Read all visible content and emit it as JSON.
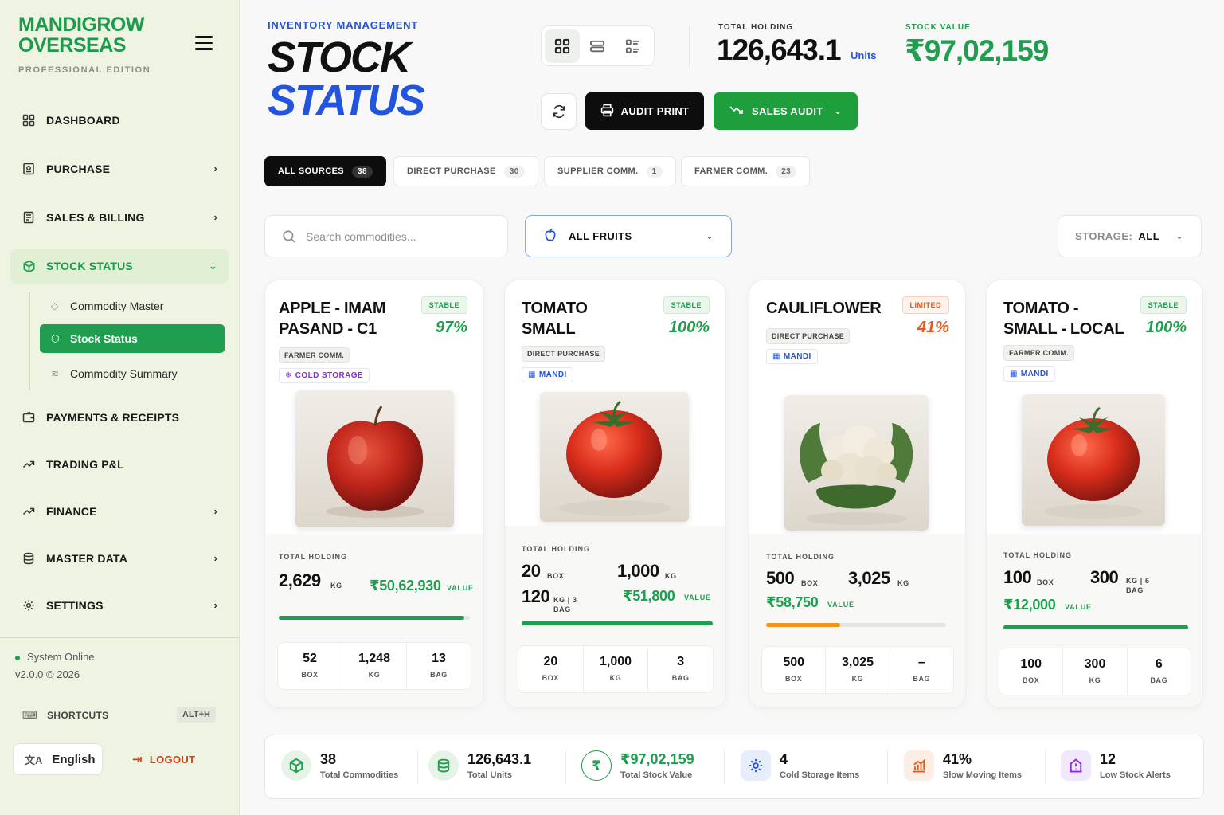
{
  "brand": {
    "name": "MANDIGROW OVERSEAS",
    "name_line1": "MANDIGROW",
    "name_line2": "OVERSEAS",
    "edition": "PROFESSIONAL EDITION"
  },
  "sidebar": {
    "items": [
      {
        "label": "DASHBOARD",
        "icon": "grid-icon",
        "has_chevron": false
      },
      {
        "label": "PURCHASE",
        "icon": "receipt-icon",
        "has_chevron": true
      },
      {
        "label": "SALES & BILLING",
        "icon": "invoice-icon",
        "has_chevron": true
      },
      {
        "label": "STOCK STATUS",
        "icon": "box-icon",
        "has_chevron": true,
        "active": true
      },
      {
        "label": "PAYMENTS & RECEIPTS",
        "icon": "wallet-icon",
        "has_chevron": false
      },
      {
        "label": "TRADING P&L",
        "icon": "trend-icon",
        "has_chevron": false
      },
      {
        "label": "FINANCE",
        "icon": "trend-icon",
        "has_chevron": true
      },
      {
        "label": "MASTER DATA",
        "icon": "database-icon",
        "has_chevron": true
      },
      {
        "label": "SETTINGS",
        "icon": "gear-icon",
        "has_chevron": true
      }
    ],
    "sub_items": [
      {
        "label": "Commodity Master",
        "icon": "tag-icon"
      },
      {
        "label": "Stock Status",
        "icon": "box-icon",
        "active": true
      },
      {
        "label": "Commodity Summary",
        "icon": "layers-icon"
      }
    ],
    "status": "System Online",
    "version": "v2.0.0 © 2026",
    "shortcuts_label": "SHORTCUTS",
    "shortcuts_key": "ALT+H",
    "language": "English",
    "logout": "LOGOUT"
  },
  "header": {
    "kicker": "INVENTORY MANAGEMENT",
    "title_line1": "STOCK",
    "title_line2": "STATUS",
    "total_holding_label": "TOTAL HOLDING",
    "total_holding_value": "126,643.1",
    "total_holding_unit": "Units",
    "stock_value_label": "STOCK VALUE",
    "stock_value": "₹97,02,159",
    "audit_print": "AUDIT PRINT",
    "sales_audit": "SALES AUDIT"
  },
  "filters": {
    "pills": [
      {
        "label": "ALL SOURCES",
        "count": "38",
        "active": true
      },
      {
        "label": "DIRECT PURCHASE",
        "count": "30"
      },
      {
        "label": "SUPPLIER COMM.",
        "count": "1"
      },
      {
        "label": "FARMER COMM.",
        "count": "23"
      }
    ],
    "search_placeholder": "Search commodities...",
    "category": "ALL FRUITS",
    "storage_label": "STORAGE:",
    "storage_value": "ALL"
  },
  "cards": [
    {
      "name": "APPLE - IMAM PASAND - C1",
      "name_line1": "APPLE - IMAM",
      "name_line2": "PASAND - C1",
      "badge": "STABLE",
      "percent": "97%",
      "source": "FARMER COMM.",
      "tag": "COLD STORAGE",
      "holding_label": "TOTAL HOLDING",
      "holding_value": "2,629",
      "holding_unit": "KG",
      "value": "₹50,62,930",
      "value_label": "VALUE",
      "progress": 0.97,
      "stats": [
        {
          "num": "52",
          "unit": "BOX"
        },
        {
          "num": "1,248",
          "unit": "KG"
        },
        {
          "num": "13",
          "unit": "BAG"
        }
      ]
    },
    {
      "name": "TOMATO SMALL",
      "name_line1": "TOMATO",
      "name_line2": "SMALL",
      "badge": "STABLE",
      "percent": "100%",
      "source": "DIRECT PURCHASE",
      "tag": "MANDI",
      "holding_label": "TOTAL HOLDING",
      "h1_value": "20",
      "h1_unit": "BOX",
      "h2_value": "1,000",
      "h2_unit": "KG",
      "h3_value": "120",
      "h3_unit_a": "KG | 3",
      "h3_unit_b": "BAG",
      "value": "₹51,800",
      "value_label": "VALUE",
      "progress": 1.0,
      "stats": [
        {
          "num": "20",
          "unit": "BOX"
        },
        {
          "num": "1,000",
          "unit": "KG"
        },
        {
          "num": "3",
          "unit": "BAG"
        }
      ]
    },
    {
      "name": "CAULIFLOWER",
      "name_line1": "CAULIFLOWER",
      "badge": "LIMITED",
      "percent": "41%",
      "source": "DIRECT PURCHASE",
      "tag": "MANDI",
      "holding_label": "TOTAL HOLDING",
      "h1_value": "500",
      "h1_unit": "BOX",
      "h2_value": "3,025",
      "h2_unit": "KG",
      "value": "₹58,750",
      "value_label": "VALUE",
      "progress": 0.41,
      "stats": [
        {
          "num": "500",
          "unit": "BOX"
        },
        {
          "num": "3,025",
          "unit": "KG"
        },
        {
          "num": "–",
          "unit": "BAG"
        }
      ]
    },
    {
      "name": "TOMATO - SMALL - LOCAL",
      "name_line1": "TOMATO -",
      "name_line2": "SMALL - LOCAL",
      "badge": "STABLE",
      "percent": "100%",
      "source": "FARMER COMM.",
      "tag": "MANDI",
      "holding_label": "TOTAL HOLDING",
      "h1_value": "100",
      "h1_unit": "BOX",
      "h2_value": "300",
      "h2_unit_a": "KG | 6",
      "h2_unit_b": "BAG",
      "value": "₹12,000",
      "value_label": "VALUE",
      "progress": 1.0,
      "stats": [
        {
          "num": "100",
          "unit": "BOX"
        },
        {
          "num": "300",
          "unit": "KG"
        },
        {
          "num": "6",
          "unit": "BAG"
        }
      ]
    }
  ],
  "summary": [
    {
      "value": "38",
      "label": "Total Commodities",
      "icon": "box-icon"
    },
    {
      "value": "126,643.1",
      "label": "Total Units",
      "icon": "stack-icon"
    },
    {
      "value": "₹97,02,159",
      "label": "Total Stock Value",
      "icon": "rupee-icon",
      "green": true
    },
    {
      "value": "4",
      "label": "Cold Storage Items",
      "icon": "snowflake-icon"
    },
    {
      "value": "41%",
      "label": "Slow Moving Items",
      "icon": "chart-icon"
    },
    {
      "value": "12",
      "label": "Low Stock Alerts",
      "icon": "alert-icon"
    }
  ],
  "colors": {
    "brand_green": "#1f9e4f",
    "accent_blue": "#2254e0",
    "warn_orange": "#e25a22",
    "dark": "#0d0d0d"
  }
}
